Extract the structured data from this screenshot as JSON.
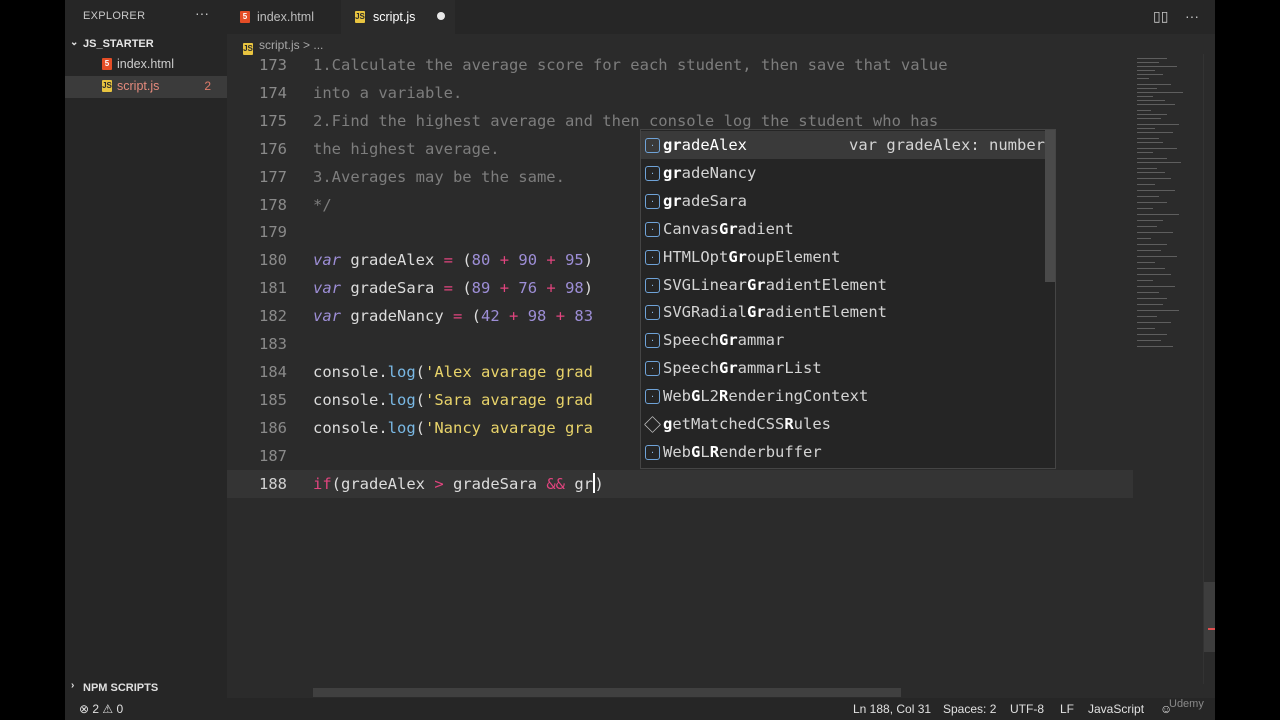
{
  "sidebar": {
    "title": "EXPLORER",
    "more": "···",
    "folder": "JS_STARTER",
    "files": [
      {
        "name": "index.html",
        "icon": "5",
        "errors": ""
      },
      {
        "name": "script.js",
        "icon": "JS",
        "errors": "2"
      }
    ],
    "npm_scripts": "NPM SCRIPTS"
  },
  "tabs": [
    {
      "label": "index.html",
      "icon": "5"
    },
    {
      "label": "script.js",
      "icon": "JS"
    }
  ],
  "toolbar": {
    "split_icon": "▯▯",
    "more_icon": "···"
  },
  "breadcrumb": {
    "icon": "JS",
    "file": "script.js",
    "sep": ">",
    "rest": "..."
  },
  "editor": {
    "lines": [
      {
        "n": "173",
        "tokens": [
          {
            "c": "cm",
            "t": "1.Calculate the average score for each student, then save that value"
          }
        ]
      },
      {
        "n": "174",
        "tokens": [
          {
            "c": "cm",
            "t": "into a variable."
          }
        ]
      },
      {
        "n": "175",
        "tokens": [
          {
            "c": "cm",
            "t": "2.Find the highest average and then console log the student who has"
          }
        ]
      },
      {
        "n": "176",
        "tokens": [
          {
            "c": "cm",
            "t": "the highest average."
          }
        ]
      },
      {
        "n": "177",
        "tokens": [
          {
            "c": "cm",
            "t": "3.Averages may be the same."
          }
        ]
      },
      {
        "n": "178",
        "tokens": [
          {
            "c": "cm",
            "t": "*/"
          }
        ]
      },
      {
        "n": "179",
        "tokens": []
      },
      {
        "n": "180",
        "tokens": [
          {
            "c": "kw",
            "t": "var"
          },
          {
            "c": "",
            "t": " gradeAlex "
          },
          {
            "c": "op",
            "t": "="
          },
          {
            "c": "",
            "t": " ("
          },
          {
            "c": "num",
            "t": "80"
          },
          {
            "c": "",
            "t": " "
          },
          {
            "c": "op",
            "t": "+"
          },
          {
            "c": "",
            "t": " "
          },
          {
            "c": "num",
            "t": "90"
          },
          {
            "c": "",
            "t": " "
          },
          {
            "c": "op",
            "t": "+"
          },
          {
            "c": "",
            "t": " "
          },
          {
            "c": "num",
            "t": "95"
          },
          {
            "c": "",
            "t": ")"
          }
        ]
      },
      {
        "n": "181",
        "tokens": [
          {
            "c": "kw",
            "t": "var"
          },
          {
            "c": "",
            "t": " gradeSara "
          },
          {
            "c": "op",
            "t": "="
          },
          {
            "c": "",
            "t": " ("
          },
          {
            "c": "num",
            "t": "89"
          },
          {
            "c": "",
            "t": " "
          },
          {
            "c": "op",
            "t": "+"
          },
          {
            "c": "",
            "t": " "
          },
          {
            "c": "num",
            "t": "76"
          },
          {
            "c": "",
            "t": " "
          },
          {
            "c": "op",
            "t": "+"
          },
          {
            "c": "",
            "t": " "
          },
          {
            "c": "num",
            "t": "98"
          },
          {
            "c": "",
            "t": ")"
          }
        ]
      },
      {
        "n": "182",
        "tokens": [
          {
            "c": "kw",
            "t": "var"
          },
          {
            "c": "",
            "t": " gradeNancy "
          },
          {
            "c": "op",
            "t": "="
          },
          {
            "c": "",
            "t": " ("
          },
          {
            "c": "num",
            "t": "42"
          },
          {
            "c": "",
            "t": " "
          },
          {
            "c": "op",
            "t": "+"
          },
          {
            "c": "",
            "t": " "
          },
          {
            "c": "num",
            "t": "98"
          },
          {
            "c": "",
            "t": " "
          },
          {
            "c": "op",
            "t": "+"
          },
          {
            "c": "",
            "t": " "
          },
          {
            "c": "num",
            "t": "83"
          }
        ]
      },
      {
        "n": "183",
        "tokens": []
      },
      {
        "n": "184",
        "tokens": [
          {
            "c": "",
            "t": "console."
          },
          {
            "c": "fn",
            "t": "log"
          },
          {
            "c": "",
            "t": "("
          },
          {
            "c": "str",
            "t": "'Alex avarage grad"
          }
        ]
      },
      {
        "n": "185",
        "tokens": [
          {
            "c": "",
            "t": "console."
          },
          {
            "c": "fn",
            "t": "log"
          },
          {
            "c": "",
            "t": "("
          },
          {
            "c": "str",
            "t": "'Sara avarage grad"
          }
        ]
      },
      {
        "n": "186",
        "tokens": [
          {
            "c": "",
            "t": "console."
          },
          {
            "c": "fn",
            "t": "log"
          },
          {
            "c": "",
            "t": "("
          },
          {
            "c": "str",
            "t": "'Nancy avarage gra"
          }
        ]
      },
      {
        "n": "187",
        "tokens": []
      },
      {
        "n": "188",
        "current": true,
        "tokens": [
          {
            "c": "kw2",
            "t": "if"
          },
          {
            "c": "",
            "t": "(gradeAlex "
          },
          {
            "c": "op",
            "t": ">"
          },
          {
            "c": "",
            "t": " gradeSara "
          },
          {
            "c": "op",
            "t": "&&"
          },
          {
            "c": "",
            "t": " gr"
          },
          {
            "c": "cursor",
            "t": ""
          },
          {
            "c": "",
            "t": ")"
          }
        ]
      }
    ]
  },
  "suggestions": [
    {
      "parts": [
        {
          "b": "gr"
        },
        {
          "t": "adeAlex"
        }
      ],
      "detail": "var gradeAlex: number",
      "icon": "var",
      "selected": true
    },
    {
      "parts": [
        {
          "b": "gr"
        },
        {
          "t": "adeNancy"
        }
      ],
      "detail": "",
      "icon": "var"
    },
    {
      "parts": [
        {
          "b": "gr"
        },
        {
          "t": "adeSara"
        }
      ],
      "detail": "",
      "icon": "var"
    },
    {
      "parts": [
        {
          "t": "Canvas"
        },
        {
          "b": "Gr"
        },
        {
          "t": "adient"
        }
      ],
      "detail": "",
      "icon": "var"
    },
    {
      "parts": [
        {
          "t": "HTMLOpt"
        },
        {
          "b": "Gr"
        },
        {
          "t": "oupElement"
        }
      ],
      "detail": "",
      "icon": "var"
    },
    {
      "parts": [
        {
          "t": "SVGLinear"
        },
        {
          "b": "Gr"
        },
        {
          "t": "adientElement"
        }
      ],
      "detail": "",
      "icon": "var"
    },
    {
      "parts": [
        {
          "t": "SVGRadial"
        },
        {
          "b": "Gr"
        },
        {
          "t": "adientElement"
        }
      ],
      "detail": "",
      "icon": "var"
    },
    {
      "parts": [
        {
          "t": "Speech"
        },
        {
          "b": "Gr"
        },
        {
          "t": "ammar"
        }
      ],
      "detail": "",
      "icon": "var"
    },
    {
      "parts": [
        {
          "t": "Speech"
        },
        {
          "b": "Gr"
        },
        {
          "t": "ammarList"
        }
      ],
      "detail": "",
      "icon": "var"
    },
    {
      "parts": [
        {
          "t": "Web"
        },
        {
          "b": "G"
        },
        {
          "t": "L2"
        },
        {
          "b": "R"
        },
        {
          "t": "enderingContext"
        }
      ],
      "detail": "",
      "icon": "var"
    },
    {
      "parts": [
        {
          "b": "g"
        },
        {
          "t": "etMatchedCSS"
        },
        {
          "b": "R"
        },
        {
          "t": "ules"
        }
      ],
      "detail": "",
      "icon": "method"
    },
    {
      "parts": [
        {
          "t": "Web"
        },
        {
          "b": "G"
        },
        {
          "t": "L"
        },
        {
          "b": "R"
        },
        {
          "t": "enderbuffer"
        }
      ],
      "detail": "",
      "icon": "var"
    }
  ],
  "status": {
    "errors": "⊗ 2 ⚠ 0",
    "position": "Ln 188, Col 31",
    "spaces": "Spaces: 2",
    "encoding": "UTF-8",
    "eol": "LF",
    "language": "JavaScript",
    "feedback": "☺",
    "watermark": "Udemy"
  },
  "colors": {
    "accent_js": "#e8c440",
    "accent_html": "#e44d26"
  }
}
